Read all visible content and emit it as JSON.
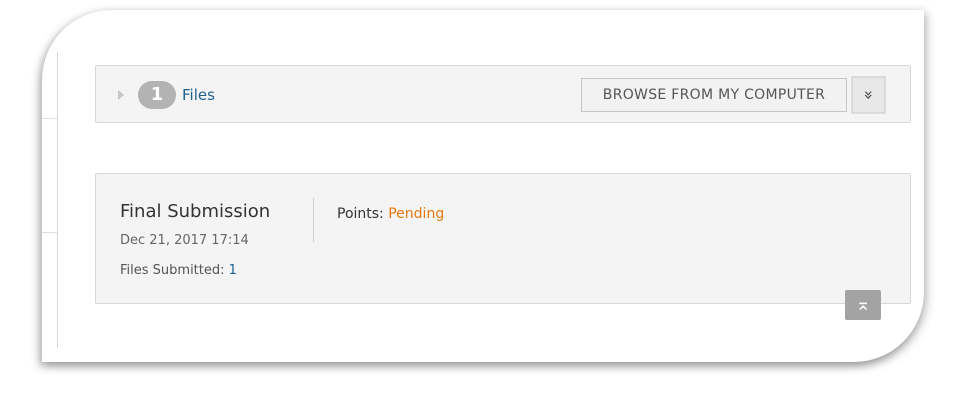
{
  "files_bar": {
    "count": "1",
    "label": "Files",
    "browse_label": "BROWSE FROM MY COMPUTER",
    "menu_icon": "double-chevron-down-icon"
  },
  "submission": {
    "title": "Final Submission",
    "date": "Dec 21, 2017 17:14",
    "files_label": "Files Submitted:",
    "files_count": "1",
    "points_label": "Points:",
    "points_value": "Pending"
  },
  "back_to_top_icon": "back-to-top-icon",
  "colors": {
    "link": "#1f5f8e",
    "pending": "#e5780e",
    "panel_bg": "#f4f4f4",
    "pill_bg": "#b3b3b3"
  }
}
